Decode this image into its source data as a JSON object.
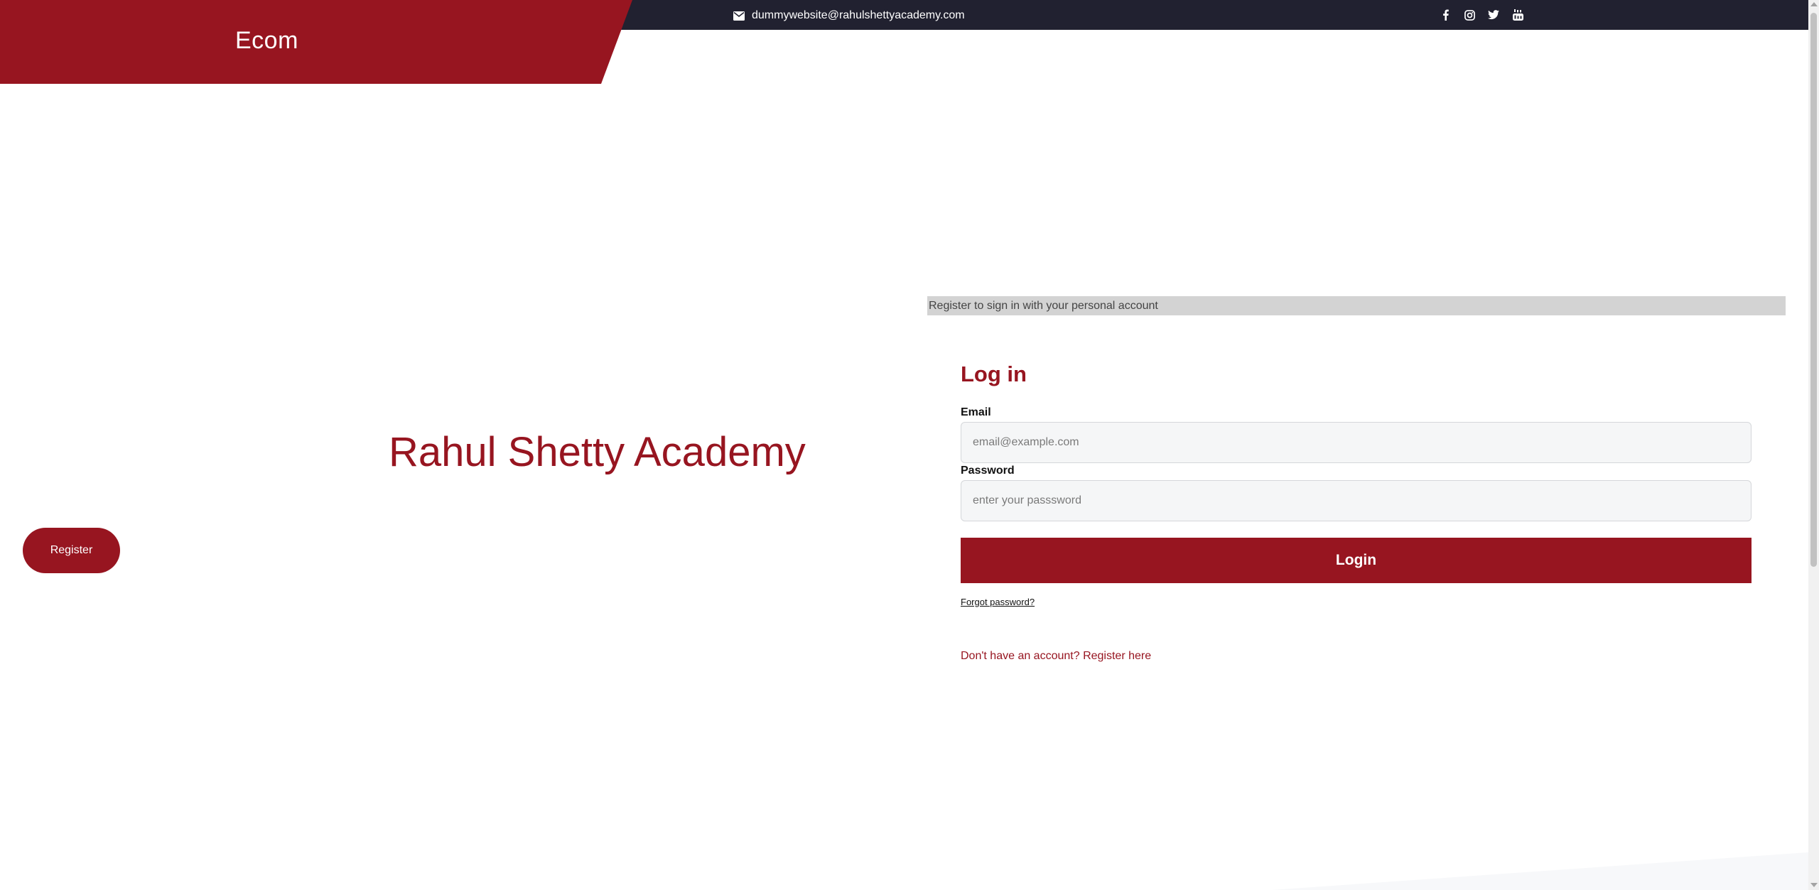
{
  "header": {
    "brand": "Ecom",
    "contact_email": "dummywebsite@rahulshettyacademy.com",
    "contact_icon": "envelope-icon",
    "social": [
      {
        "name": "facebook-icon"
      },
      {
        "name": "instagram-icon"
      },
      {
        "name": "twitter-icon"
      },
      {
        "name": "youtube-icon"
      }
    ]
  },
  "hero": {
    "title": "Rahul Shetty Academy",
    "register_button": "Register"
  },
  "login": {
    "info_banner": "Register to sign in with your personal account",
    "title": "Log in",
    "email_label": "Email",
    "email_placeholder": "email@example.com",
    "password_label": "Password",
    "password_placeholder": "enter your passsword",
    "login_button": "Login",
    "forgot_password": "Forgot password?",
    "register_link": "Don't have an account? Register here"
  },
  "colors": {
    "brand": "#971520",
    "topbar": "#212130",
    "banner": "#d3d3d3"
  }
}
